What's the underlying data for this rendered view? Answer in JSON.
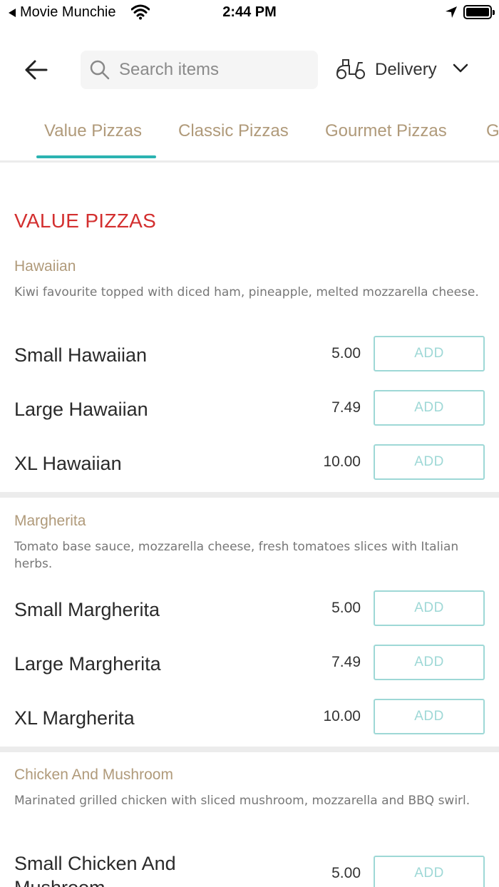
{
  "status_bar": {
    "back_app": "Movie Munchie",
    "time": "2:44 PM"
  },
  "header": {
    "search_placeholder": "Search items",
    "delivery_label": "Delivery"
  },
  "tabs": [
    {
      "label": "Value Pizzas",
      "active": true
    },
    {
      "label": "Classic Pizzas",
      "active": false
    },
    {
      "label": "Gourmet Pizzas",
      "active": false
    },
    {
      "label": "G",
      "active": false
    }
  ],
  "section": {
    "title": "VALUE PIZZAS"
  },
  "groups": [
    {
      "name": "Hawaiian",
      "description": "Kiwi favourite topped with diced ham, pineapple, melted mozzarella cheese.",
      "items": [
        {
          "name": "Small Hawaiian",
          "price": "5.00",
          "button": "ADD"
        },
        {
          "name": "Large Hawaiian",
          "price": "7.49",
          "button": "ADD"
        },
        {
          "name": "XL Hawaiian",
          "price": "10.00",
          "button": "ADD"
        }
      ]
    },
    {
      "name": "Margherita",
      "description": "Tomato base sauce, mozzarella cheese, fresh tomatoes slices with Italian herbs.",
      "items": [
        {
          "name": "Small Margherita",
          "price": "5.00",
          "button": "ADD"
        },
        {
          "name": "Large Margherita",
          "price": "7.49",
          "button": "ADD"
        },
        {
          "name": "XL Margherita",
          "price": "10.00",
          "button": "ADD"
        }
      ]
    },
    {
      "name": "Chicken And Mushroom",
      "description": "Marinated grilled chicken with sliced mushroom, mozzarella and BBQ swirl.",
      "items": [
        {
          "name": "Small Chicken And Mushroom",
          "price": "5.00",
          "button": "ADD"
        }
      ]
    }
  ],
  "colors": {
    "accent": "#2bb3b1",
    "section_title": "#d32f2f",
    "group_name": "#b09a7a",
    "add_button": "#9ed8d6"
  },
  "icons": [
    "back-arrow-icon",
    "search-icon",
    "scooter-icon",
    "chevron-down-icon",
    "wifi-icon",
    "location-arrow-icon",
    "battery-icon"
  ]
}
